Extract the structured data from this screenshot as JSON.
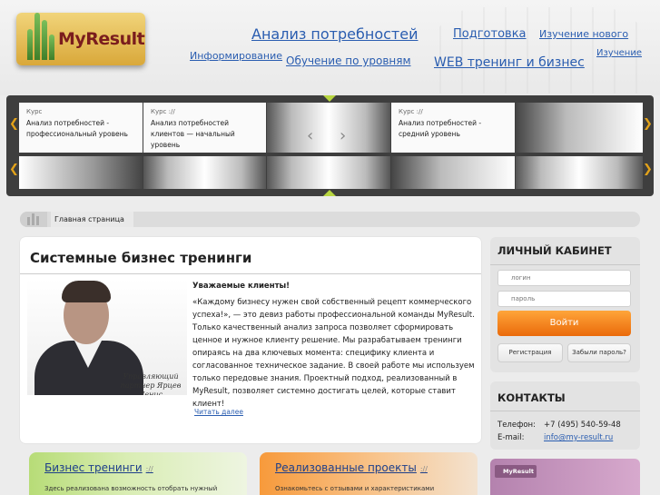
{
  "logo": {
    "text": "MyResult"
  },
  "nav": {
    "analysis": "Анализ потребностей",
    "preparation": "Подготовка",
    "study_new": "Изучение нового",
    "informing": "Информирование",
    "level_training": "Обучение по уровням",
    "web_training": "WEB тренинг и бизнес",
    "study": "Изучение"
  },
  "slider": {
    "slides": [
      {
        "tag": "Курс",
        "title": "Анализ потребностей - профессиональный уровень"
      },
      {
        "tag": "Курс ://",
        "title": "Анализ потребностей клиентов — начальный уровень"
      },
      {
        "tag": "Курс ://",
        "title": "Анализ потребностей - средний уровень"
      }
    ],
    "prev_icon": "‹",
    "next_icon": "›",
    "arrow_left": "❮",
    "arrow_right": "❯"
  },
  "breadcrumb": {
    "home": "Главная страница"
  },
  "main": {
    "title": "Системные бизнес тренинги",
    "caption": "Управляющий партнер Ярцев Денис",
    "greeting": "Уважаемые клиенты!",
    "body": "«Каждому бизнесу нужен свой собственный рецепт коммерческого успеха!», — это девиз работы профессиональной команды MyResult. Только качественный анализ запроса позволяет сформировать ценное и нужное клиенту решение. Мы разрабатываем тренинги опираясь на два ключевых момента: специфику клиента и согласованное техническое задание. В своей работе мы используем только передовые знания. Проектный подход, реализованный в MyResult, позволяет системно достигать целей, которые ставит клиент!",
    "read_more": "Читать далее"
  },
  "login": {
    "title": "ЛИЧНЫЙ КАБИНЕТ",
    "login_placeholder": "логин",
    "password_placeholder": "пароль",
    "submit": "Войти",
    "register": "Регистрация",
    "forgot": "Забыли пароль?"
  },
  "contacts": {
    "title": "КОНТАКТЫ",
    "phone_label": "Телефон:",
    "phone": "+7 (495) 540-59-48",
    "email_label": "E-mail:",
    "email": "info@my-result.ru"
  },
  "bottom": {
    "trainings_title": "Бизнес тренинги",
    "trainings_sep": "://",
    "trainings_text": "Здесь реализована возможность отобрать нужный",
    "projects_title": "Реализованные проекты",
    "projects_sep": "://",
    "projects_text": "Ознакомьтесь с отзывами и характеристиками"
  },
  "promo": {
    "logo": "MyResult"
  }
}
